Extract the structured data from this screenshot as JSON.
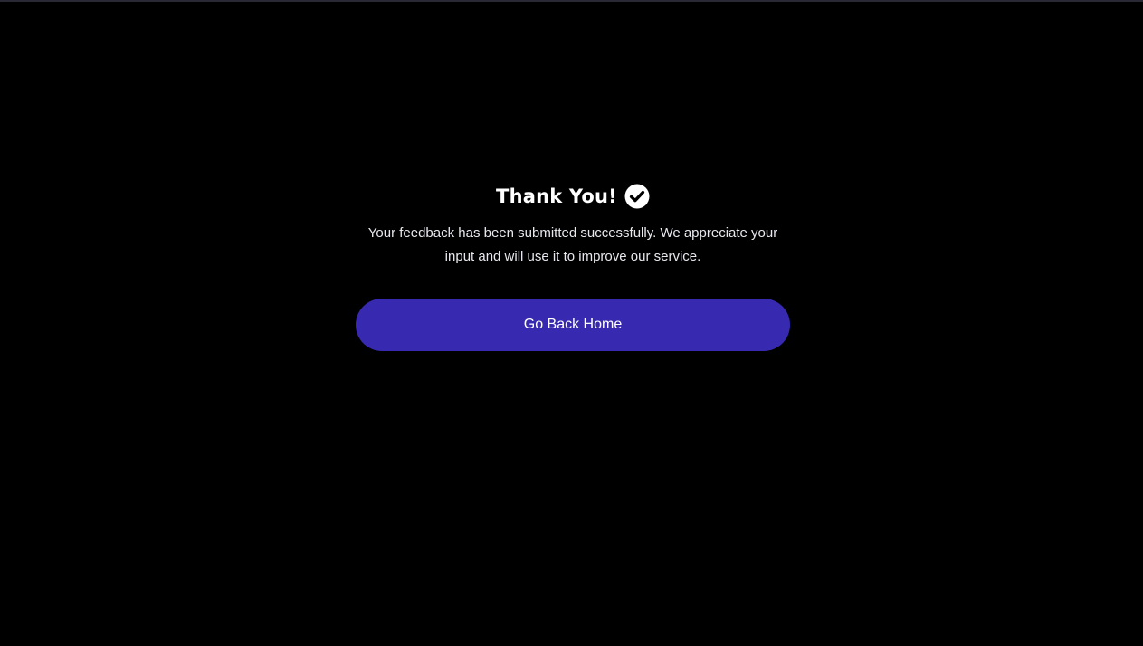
{
  "thank_you": {
    "title": "Thank You!",
    "message": "Your feedback has been submitted successfully. We appreciate your input and will use it to improve our service.",
    "icon": "check-circle-icon"
  },
  "actions": {
    "home_label": "Go Back Home"
  },
  "colors": {
    "background": "#000000",
    "button": "#372ab0",
    "text": "#ffffff"
  }
}
